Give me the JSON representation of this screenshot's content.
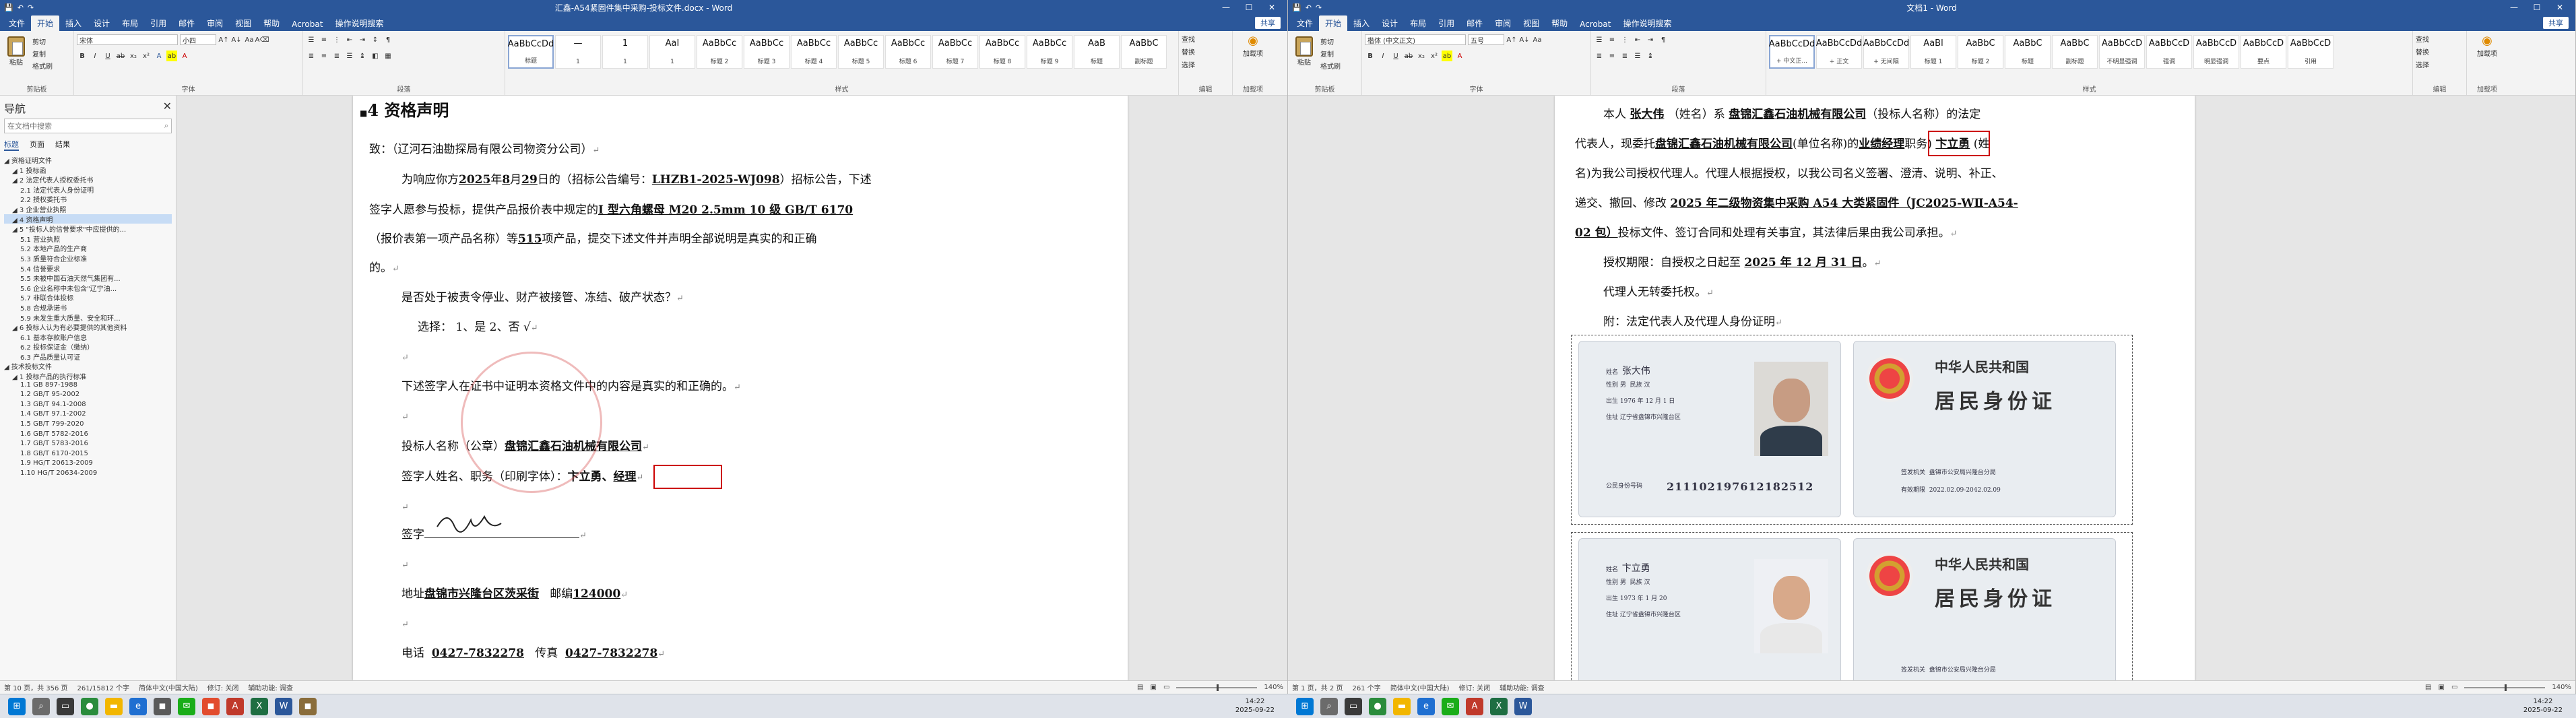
{
  "left": {
    "window_title": "汇鑫-A54紧固件集中采购-投标文件.docx - Word",
    "quick_access": [
      "文件"
    ],
    "tabs": [
      "文件",
      "开始",
      "插入",
      "设计",
      "布局",
      "引用",
      "邮件",
      "审阅",
      "视图",
      "帮助",
      "Acrobat",
      "操作说明搜索"
    ],
    "share": "共享",
    "font_name": "宋体",
    "font_size": "小四",
    "groups": {
      "clipboard": "剪贴板",
      "font": "字体",
      "paragraph": "段落",
      "styles": "样式",
      "editing": "编辑",
      "addins": "加载项"
    },
    "paste_label": "粘贴",
    "cut_label": "剪切",
    "copy_label": "复制",
    "format_label": "格式刷",
    "styles": [
      {
        "sample": "AaBbCcDd",
        "name": "标题"
      },
      {
        "sample": "—",
        "name": "1"
      },
      {
        "sample": "1",
        "name": "1"
      },
      {
        "sample": "AaI",
        "name": "1"
      },
      {
        "sample": "AaBbCc",
        "name": "标题 2"
      },
      {
        "sample": "AaBbCc",
        "name": "标题 3"
      },
      {
        "sample": "AaBbCc",
        "name": "标题 4"
      },
      {
        "sample": "AaBbCc",
        "name": "标题 5"
      },
      {
        "sample": "AaBbCc",
        "name": "标题 6"
      },
      {
        "sample": "AaBbCc",
        "name": "标题 7"
      },
      {
        "sample": "AaBbCc",
        "name": "标题 8"
      },
      {
        "sample": "AaBbCc",
        "name": "标题 9"
      },
      {
        "sample": "AaB",
        "name": "标题"
      },
      {
        "sample": "AaBbC",
        "name": "副标题"
      }
    ],
    "edit": [
      "查找",
      "替换",
      "选择"
    ],
    "addin": "加载项",
    "nav": {
      "title": "导航",
      "search_placeholder": "在文档中搜索",
      "tabs": [
        "标题",
        "页面",
        "结果"
      ],
      "items": [
        {
          "t": "资格证明文件",
          "lv": 1
        },
        {
          "t": "1 投标函",
          "lv": 2
        },
        {
          "t": "2 法定代表人授权委托书",
          "lv": 2
        },
        {
          "t": "2.1 法定代表人身份证明",
          "lv": 3
        },
        {
          "t": "2.2 授权委托书",
          "lv": 3
        },
        {
          "t": "3 企业营业执照",
          "lv": 2
        },
        {
          "t": "4 资格声明",
          "lv": 2,
          "sel": true
        },
        {
          "t": "5 \"投标人的信誉要求\"中应提供的...",
          "lv": 2
        },
        {
          "t": "5.1 营业执照",
          "lv": 3
        },
        {
          "t": "5.2 本地产品的生产商",
          "lv": 3
        },
        {
          "t": "5.3 质量符合企业标准",
          "lv": 3
        },
        {
          "t": "5.4 信誉要求",
          "lv": 3
        },
        {
          "t": "5.5 未被中国石油天然气集团有...",
          "lv": 3
        },
        {
          "t": "5.6 企业名称中未包含\"辽宁油...",
          "lv": 3
        },
        {
          "t": "5.7 非联合体投标",
          "lv": 3
        },
        {
          "t": "5.8 合规承诺书",
          "lv": 3
        },
        {
          "t": "5.9 未发生重大质量、安全和环...",
          "lv": 3
        },
        {
          "t": "6 投标人认为有必要提供的其他资料",
          "lv": 2
        },
        {
          "t": "6.1 基本存款账户信息",
          "lv": 3
        },
        {
          "t": "6.2 投标保证金（缴纳）",
          "lv": 3
        },
        {
          "t": "6.3 产品质量认可证",
          "lv": 3
        },
        {
          "t": "技术投标文件",
          "lv": 1
        },
        {
          "t": "1 投标产品的执行标准",
          "lv": 2
        },
        {
          "t": "1.1 GB 897-1988",
          "lv": 3
        },
        {
          "t": "1.2 GB/T 95-2002",
          "lv": 3
        },
        {
          "t": "1.3 GB/T 94.1-2008",
          "lv": 3
        },
        {
          "t": "1.4 GB/T 97.1-2002",
          "lv": 3
        },
        {
          "t": "1.5 GB/T 799-2020",
          "lv": 3
        },
        {
          "t": "1.6 GB/T 5782-2016",
          "lv": 3
        },
        {
          "t": "1.7 GB/T 5783-2016",
          "lv": 3
        },
        {
          "t": "1.8 GB/T 6170-2015",
          "lv": 3
        },
        {
          "t": "1.9 HG/T 20613-2009",
          "lv": 3
        },
        {
          "t": "1.10 HG/T 20634-2009",
          "lv": 3
        }
      ]
    },
    "doc": {
      "heading": "4 资格声明",
      "to": "致：（辽河石油勘探局有限公司物资分公司）",
      "p1a": "为响应你方",
      "p1_year": "2025",
      "p1b": "年",
      "p1_month": "8",
      "p1c": "月",
      "p1_day": "29",
      "p1d": "日的（招标公告编号：",
      "p1_code": "LHZB1-2025-WJ098",
      "p1e": "）招标公告，下述",
      "p2a": "签字人愿参与投标，提供产品报价表中规定的",
      "p2_item": "I 型六角螺母 M20 2.5mm 10 级 GB/T 6170",
      "p3a": "（报价表第一项产品名称）等",
      "p3_count": "515",
      "p3b": "项产品，提交下述文件并声明全部说明是真实的和正确",
      "p4": "的。",
      "q": "是否处于被责令停业、财产被接管、冻结、破产状态？",
      "sel": "选择：  1、是              2、否 √",
      "decl": "下述签字人在证书中证明本资格文件中的内容是真实的和正确的。",
      "bidder_label": "投标人名称（公章）",
      "bidder": "盘锦汇鑫石油机械有限公司",
      "signer_label": "签字人姓名、职务（印刷字体）：",
      "signer": "卞立勇、",
      "signer_title": "经理",
      "sign_label": "签字",
      "addr_label": "地址",
      "addr": "盘锦市兴隆台区茨采街",
      "zip_label": "邮编",
      "zip": "124000",
      "tel_label": "电话",
      "tel": "0427-7832278",
      "fax_label": "传真",
      "fax": "0427-7832278"
    },
    "status": {
      "page": "第 10 页，共 356 页",
      "words": "261/15812 个字",
      "lang": "简体中文(中国大陆)",
      "track": "修订: 关闭",
      "access": "辅助功能: 调查",
      "zoom": "140%"
    }
  },
  "right": {
    "window_title": "文档1 - Word",
    "tabs": [
      "文件",
      "开始",
      "插入",
      "设计",
      "布局",
      "引用",
      "邮件",
      "审阅",
      "视图",
      "帮助",
      "Acrobat",
      "操作说明搜索"
    ],
    "share": "共享",
    "font_name": "楷体 (中文正文)",
    "font_size": "五号",
    "styles": [
      {
        "sample": "AaBbCcDd",
        "name": "+ 中文正..."
      },
      {
        "sample": "AaBbCcDd",
        "name": "+ 正文"
      },
      {
        "sample": "AaBbCcDd",
        "name": "+ 无间隔"
      },
      {
        "sample": "AaBl",
        "name": "标题 1"
      },
      {
        "sample": "AaBbC",
        "name": "标题 2"
      },
      {
        "sample": "AaBbC",
        "name": "标题"
      },
      {
        "sample": "AaBbC",
        "name": "副标题"
      },
      {
        "sample": "AaBbCcD",
        "name": "不明显强调"
      },
      {
        "sample": "AaBbCcD",
        "name": "强调"
      },
      {
        "sample": "AaBbCcD",
        "name": "明显强调"
      },
      {
        "sample": "AaBbCcD",
        "name": "要点"
      },
      {
        "sample": "AaBbCcD",
        "name": "引用"
      }
    ],
    "doc": {
      "l1a": "本人",
      "l1_name": "张大伟",
      "l1b": "（姓名）系",
      "l1_company": "盘锦汇鑫石油机械有限公司",
      "l1c": "（投标人名称）的法定",
      "l2a": "代表人，现委托",
      "l2_company": "盘锦汇鑫石油机械有限公司",
      "l2b": "(单位名称)的",
      "l2_title": "业绩经理",
      "l2c": "职务)",
      "l2_name": "卞立勇",
      "l2d": "(姓",
      "l3": "名)为我公司授权代理人。代理人根据授权，以我公司名义签署、澄清、说明、补正、",
      "l4a": "递交、撤回、修改",
      "l4_proj": "2025 年二级物资集中采购 A54 大类紧固件（JC2025-WⅡ-A54-",
      "l5_proj": "02 包）",
      "l5b": "投标文件、签订合同和处理有关事宜，其法律后果由我公司承担。",
      "l6a": "授权期限：自授权之日起至",
      "l6_date": "2025 年 12 月 31 日",
      "l6b": "。",
      "l7": "代理人无转委托权。",
      "l8": "附：法定代表人及代理人身份证明",
      "id1": {
        "name": "张大伟",
        "sex": "男",
        "nation": "汉",
        "born": "1976 年 12 月 1 日",
        "addr": "辽宁省盘锦市兴隆台区",
        "idno": "211102197612182512",
        "issuer": "盘锦市公安局兴隆台分局",
        "valid": "2022.02.09-2042.02.09"
      },
      "id2": {
        "name": "卞立勇",
        "sex": "男",
        "nation": "汉",
        "born": "1973 年 1 月 20",
        "addr": "辽宁省盘锦市兴隆台区",
        "issuer": "盘锦市公安局兴隆台分局"
      },
      "id_title1": "中华人民共和国",
      "id_title2": "居民身份证",
      "id_labels": {
        "name": "姓名",
        "sex": "性别",
        "nation": "民族",
        "born": "出生",
        "addr": "住址",
        "idno": "公民身份号码",
        "issuer": "签发机关",
        "valid": "有效期限"
      }
    },
    "status": {
      "page": "第 1 页，共 2 页",
      "words": "261 个字",
      "lang": "简体中文(中国大陆)",
      "track": "修订: 关闭",
      "access": "辅助功能: 调查",
      "zoom": "140%"
    }
  },
  "taskbar": {
    "time": "14:22",
    "date": "2025-09-22"
  }
}
